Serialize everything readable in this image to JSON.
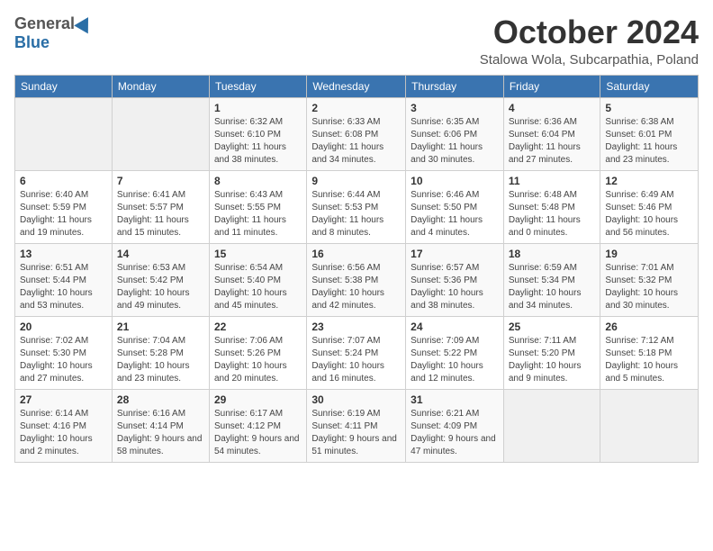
{
  "logo": {
    "general": "General",
    "blue": "Blue"
  },
  "header": {
    "month_title": "October 2024",
    "location": "Stalowa Wola, Subcarpathia, Poland"
  },
  "weekdays": [
    "Sunday",
    "Monday",
    "Tuesday",
    "Wednesday",
    "Thursday",
    "Friday",
    "Saturday"
  ],
  "weeks": [
    [
      {
        "day": "",
        "info": ""
      },
      {
        "day": "",
        "info": ""
      },
      {
        "day": "1",
        "info": "Sunrise: 6:32 AM\nSunset: 6:10 PM\nDaylight: 11 hours and 38 minutes."
      },
      {
        "day": "2",
        "info": "Sunrise: 6:33 AM\nSunset: 6:08 PM\nDaylight: 11 hours and 34 minutes."
      },
      {
        "day": "3",
        "info": "Sunrise: 6:35 AM\nSunset: 6:06 PM\nDaylight: 11 hours and 30 minutes."
      },
      {
        "day": "4",
        "info": "Sunrise: 6:36 AM\nSunset: 6:04 PM\nDaylight: 11 hours and 27 minutes."
      },
      {
        "day": "5",
        "info": "Sunrise: 6:38 AM\nSunset: 6:01 PM\nDaylight: 11 hours and 23 minutes."
      }
    ],
    [
      {
        "day": "6",
        "info": "Sunrise: 6:40 AM\nSunset: 5:59 PM\nDaylight: 11 hours and 19 minutes."
      },
      {
        "day": "7",
        "info": "Sunrise: 6:41 AM\nSunset: 5:57 PM\nDaylight: 11 hours and 15 minutes."
      },
      {
        "day": "8",
        "info": "Sunrise: 6:43 AM\nSunset: 5:55 PM\nDaylight: 11 hours and 11 minutes."
      },
      {
        "day": "9",
        "info": "Sunrise: 6:44 AM\nSunset: 5:53 PM\nDaylight: 11 hours and 8 minutes."
      },
      {
        "day": "10",
        "info": "Sunrise: 6:46 AM\nSunset: 5:50 PM\nDaylight: 11 hours and 4 minutes."
      },
      {
        "day": "11",
        "info": "Sunrise: 6:48 AM\nSunset: 5:48 PM\nDaylight: 11 hours and 0 minutes."
      },
      {
        "day": "12",
        "info": "Sunrise: 6:49 AM\nSunset: 5:46 PM\nDaylight: 10 hours and 56 minutes."
      }
    ],
    [
      {
        "day": "13",
        "info": "Sunrise: 6:51 AM\nSunset: 5:44 PM\nDaylight: 10 hours and 53 minutes."
      },
      {
        "day": "14",
        "info": "Sunrise: 6:53 AM\nSunset: 5:42 PM\nDaylight: 10 hours and 49 minutes."
      },
      {
        "day": "15",
        "info": "Sunrise: 6:54 AM\nSunset: 5:40 PM\nDaylight: 10 hours and 45 minutes."
      },
      {
        "day": "16",
        "info": "Sunrise: 6:56 AM\nSunset: 5:38 PM\nDaylight: 10 hours and 42 minutes."
      },
      {
        "day": "17",
        "info": "Sunrise: 6:57 AM\nSunset: 5:36 PM\nDaylight: 10 hours and 38 minutes."
      },
      {
        "day": "18",
        "info": "Sunrise: 6:59 AM\nSunset: 5:34 PM\nDaylight: 10 hours and 34 minutes."
      },
      {
        "day": "19",
        "info": "Sunrise: 7:01 AM\nSunset: 5:32 PM\nDaylight: 10 hours and 30 minutes."
      }
    ],
    [
      {
        "day": "20",
        "info": "Sunrise: 7:02 AM\nSunset: 5:30 PM\nDaylight: 10 hours and 27 minutes."
      },
      {
        "day": "21",
        "info": "Sunrise: 7:04 AM\nSunset: 5:28 PM\nDaylight: 10 hours and 23 minutes."
      },
      {
        "day": "22",
        "info": "Sunrise: 7:06 AM\nSunset: 5:26 PM\nDaylight: 10 hours and 20 minutes."
      },
      {
        "day": "23",
        "info": "Sunrise: 7:07 AM\nSunset: 5:24 PM\nDaylight: 10 hours and 16 minutes."
      },
      {
        "day": "24",
        "info": "Sunrise: 7:09 AM\nSunset: 5:22 PM\nDaylight: 10 hours and 12 minutes."
      },
      {
        "day": "25",
        "info": "Sunrise: 7:11 AM\nSunset: 5:20 PM\nDaylight: 10 hours and 9 minutes."
      },
      {
        "day": "26",
        "info": "Sunrise: 7:12 AM\nSunset: 5:18 PM\nDaylight: 10 hours and 5 minutes."
      }
    ],
    [
      {
        "day": "27",
        "info": "Sunrise: 6:14 AM\nSunset: 4:16 PM\nDaylight: 10 hours and 2 minutes."
      },
      {
        "day": "28",
        "info": "Sunrise: 6:16 AM\nSunset: 4:14 PM\nDaylight: 9 hours and 58 minutes."
      },
      {
        "day": "29",
        "info": "Sunrise: 6:17 AM\nSunset: 4:12 PM\nDaylight: 9 hours and 54 minutes."
      },
      {
        "day": "30",
        "info": "Sunrise: 6:19 AM\nSunset: 4:11 PM\nDaylight: 9 hours and 51 minutes."
      },
      {
        "day": "31",
        "info": "Sunrise: 6:21 AM\nSunset: 4:09 PM\nDaylight: 9 hours and 47 minutes."
      },
      {
        "day": "",
        "info": ""
      },
      {
        "day": "",
        "info": ""
      }
    ]
  ]
}
